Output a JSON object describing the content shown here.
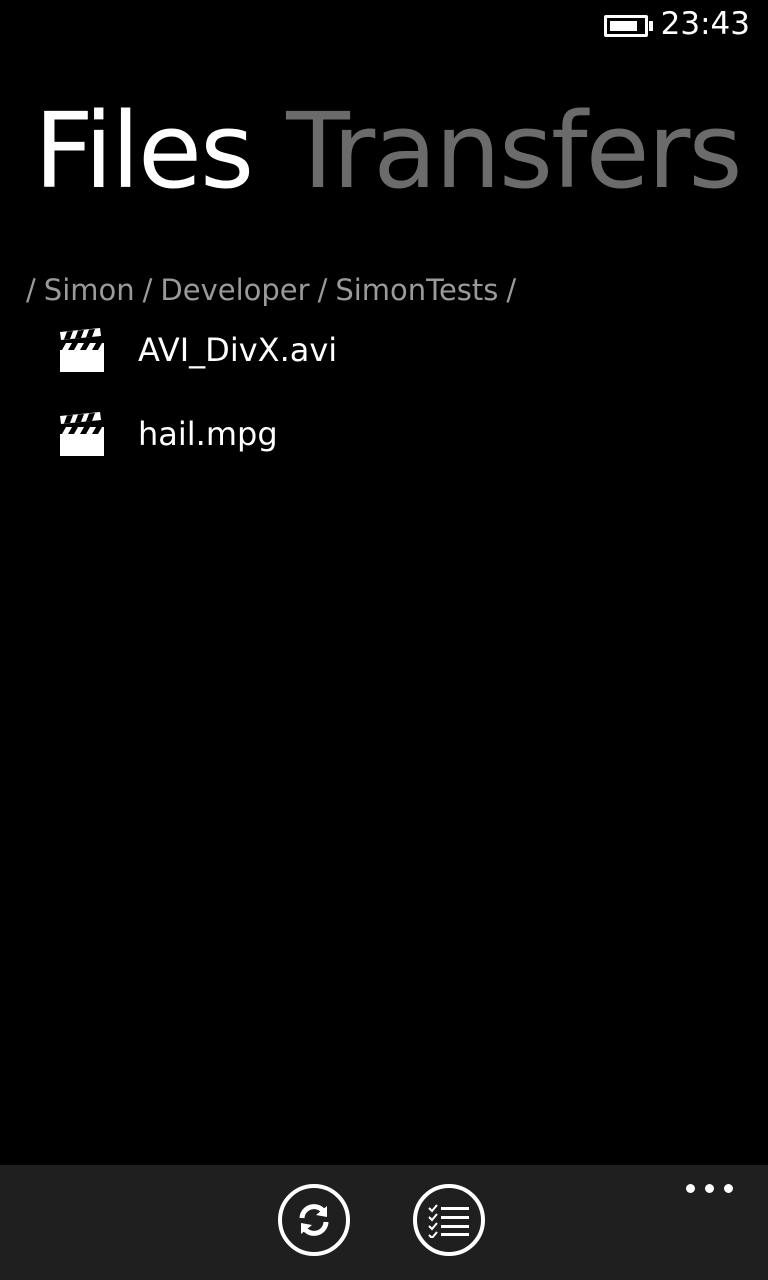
{
  "status_bar": {
    "time": "23:43",
    "battery_level": 0.85
  },
  "pivot": {
    "items": [
      {
        "label": "Files",
        "active": true
      },
      {
        "label": "Transfers",
        "active": false
      }
    ]
  },
  "breadcrumb": {
    "segments": [
      "/",
      "Simon",
      "/",
      "Developer",
      "/",
      "SimonTests",
      "/"
    ]
  },
  "files": [
    {
      "name": "AVI_DivX.avi",
      "icon": "video-clapper-icon"
    },
    {
      "name": "hail.mpg",
      "icon": "video-clapper-icon"
    }
  ],
  "app_bar": {
    "buttons": [
      {
        "icon": "refresh-icon"
      },
      {
        "icon": "select-list-icon"
      }
    ],
    "more_icon": "ellipsis-icon"
  },
  "colors": {
    "background": "#000000",
    "foreground": "#ffffff",
    "inactive": "#6b6b6b",
    "breadcrumb": "#9a9a9a",
    "app_bar": "#1f1f1f"
  }
}
